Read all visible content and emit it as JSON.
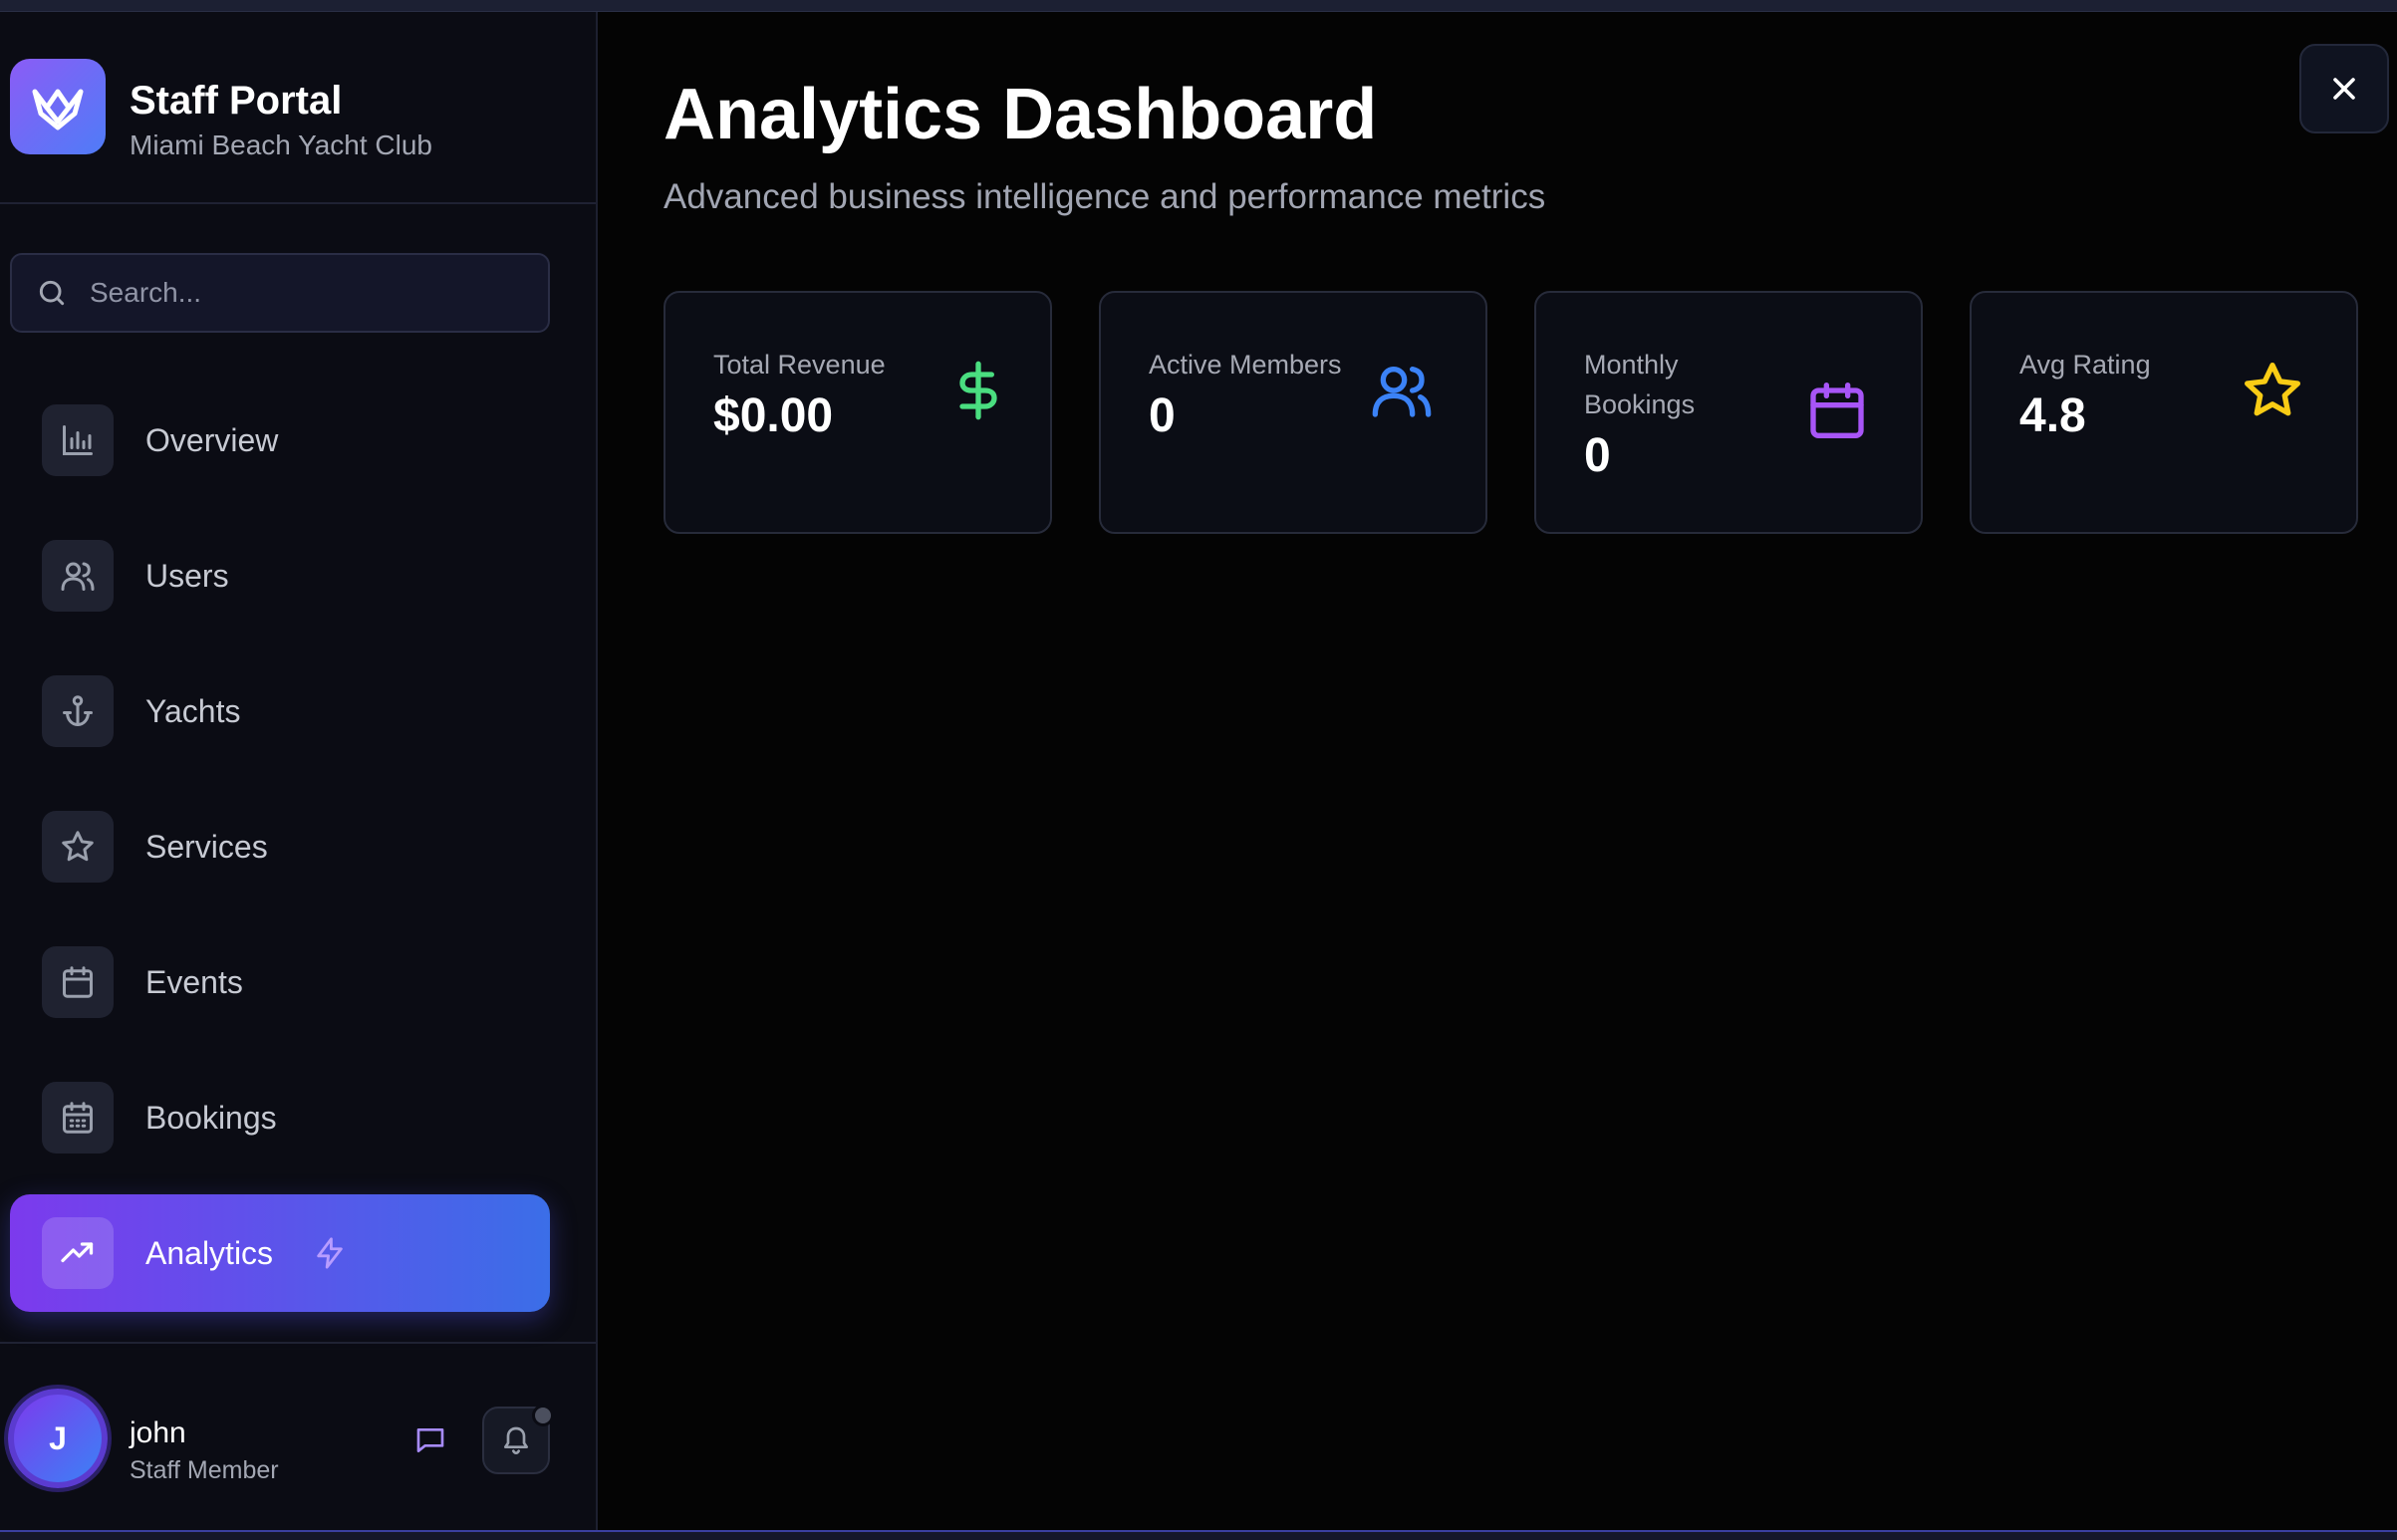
{
  "brand": {
    "title": "Staff Portal",
    "subtitle": "Miami Beach Yacht Club"
  },
  "search": {
    "placeholder": "Search..."
  },
  "sidebar": {
    "items": [
      {
        "label": "Overview",
        "icon": "bar-chart-icon",
        "active": false
      },
      {
        "label": "Users",
        "icon": "users-icon",
        "active": false
      },
      {
        "label": "Yachts",
        "icon": "anchor-icon",
        "active": false
      },
      {
        "label": "Services",
        "icon": "star-icon",
        "active": false
      },
      {
        "label": "Events",
        "icon": "calendar-icon",
        "active": false
      },
      {
        "label": "Bookings",
        "icon": "calendar-days-icon",
        "active": false
      },
      {
        "label": "Analytics",
        "icon": "trending-up-icon",
        "active": true
      }
    ]
  },
  "user": {
    "initial": "J",
    "name": "john",
    "role": "Staff Member"
  },
  "main": {
    "title": "Analytics Dashboard",
    "subtitle": "Advanced business intelligence and performance metrics"
  },
  "cards": [
    {
      "label": "Total Revenue",
      "value": "$0.00",
      "icon": "dollar-icon",
      "color": "#4ade80"
    },
    {
      "label": "Active Members",
      "value": "0",
      "icon": "users-icon",
      "color": "#3b82f6"
    },
    {
      "label": "Monthly Bookings",
      "value": "0",
      "icon": "calendar-icon",
      "color": "#a855f7"
    },
    {
      "label": "Avg Rating",
      "value": "4.8",
      "icon": "star-icon",
      "color": "#facc15"
    }
  ],
  "colors": {
    "accent_start": "#7c3aed",
    "accent_end": "#3b6ee8",
    "background": "#040404",
    "sidebar": "#0b0c14"
  }
}
